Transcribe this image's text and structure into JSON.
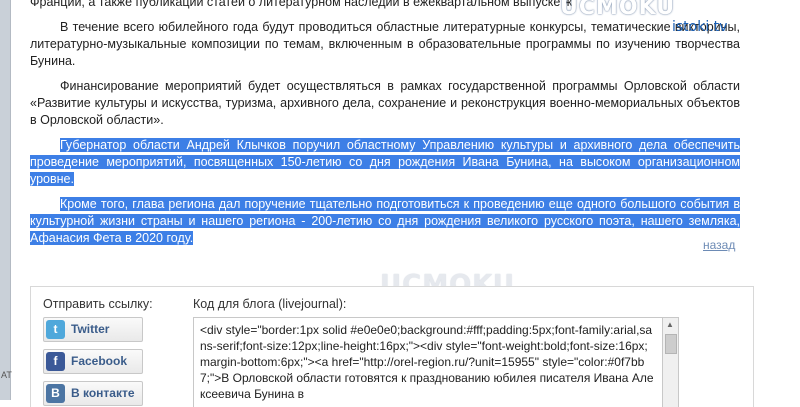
{
  "article": {
    "p1": "Франции, а также публикации статей о литературном наследии в ежеквартальном выпуске ж",
    "p2": "В течение всего юбилейного года будут проводиться областные литературные конкурсы, тематические викторины, литературно-музыкальные композиции по темам, включенным в образовательные программы по изучению творчества Бунина.",
    "p3": "Финансирование мероприятий будет осуществляться в рамках государственной программы Орловской области «Развитие культуры и искусства, туризма, архивного дела, сохранение и реконструкция военно-мемориальных объектов в Орловской области».",
    "p4": "Губернатор области Андрей Клычков поручил областному Управлению культуры и архивного дела обеспечить проведение мероприятий, посвященных 150-летию со дня рождения Ивана Бунина, на высоком организационном уровне.",
    "p5": "Кроме того, глава региона дал поручение тщательно подготовиться к проведению еще одного большого события в культурной жизни страны и нашего региона - 200-летию со дня рождения великого русского поэта, нашего земляка, Афанасия Фета в 2020 году."
  },
  "back_link": "назад",
  "watermark": {
    "top_logo": "UCMOKU",
    "site": "istoki.tv",
    "bottom_logo": "UCMOKU"
  },
  "share": {
    "title": "Отправить ссылку:",
    "twitter": "Twitter",
    "facebook": "Facebook",
    "vkontakte": "В контакте",
    "twitter_icon": "t",
    "facebook_icon": "f",
    "vk_icon": "B"
  },
  "blog": {
    "title": "Код для блога (livejournal):",
    "code": "<div style=\"border:1px solid #e0e0e0;background:#fff;padding:5px;font-family:arial,sans-serif;font-size:12px;line-height:16px;\"><div style=\"font-weight:bold;font-size:16px;margin-bottom:6px;\"><a href=\"http://orel-region.ru/?unit=15955\" style=\"color:#0f7bb7;\">В Орловской области готовятся к празднованию юбилея писателя Ивана Алексеевича Бунина в"
  },
  "colors": {
    "selection": "#3d7fe6",
    "link": "#6d8bb5",
    "site_text": "#1a5fb4"
  }
}
